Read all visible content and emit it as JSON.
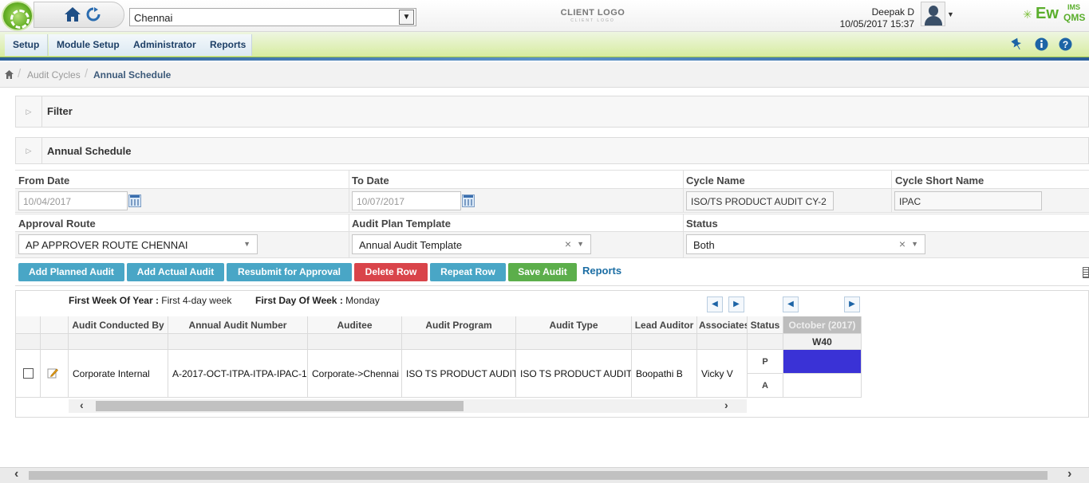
{
  "header": {
    "location": "Chennai",
    "client_logo": "CLIENT LOGO",
    "client_logo_sub": "CLIENT LOGO",
    "user_name": "Deepak D",
    "datetime": "10/05/2017 15:37",
    "brand_main": "Ew",
    "brand_top": "IMS",
    "brand_sub": "QMS"
  },
  "menu": [
    "Setup",
    "Module Setup",
    "Administrator",
    "Reports"
  ],
  "breadcrumb": [
    "Audit Cycles",
    "Annual Schedule"
  ],
  "filter_panel": {
    "title": "Filter"
  },
  "schedule_panel": {
    "title": "Annual Schedule"
  },
  "form": {
    "from_date_label": "From Date",
    "from_date": "10/04/2017",
    "to_date_label": "To Date",
    "to_date": "10/07/2017",
    "cycle_name_label": "Cycle Name",
    "cycle_name": "ISO/TS PRODUCT AUDIT CY-2",
    "cycle_short_label": "Cycle Short Name",
    "cycle_short": "IPAC",
    "approval_label": "Approval Route",
    "approval": "AP APPROVER ROUTE CHENNAI",
    "template_label": "Audit Plan Template",
    "template": "Annual Audit Template",
    "status_label": "Status",
    "status": "Both"
  },
  "buttons": {
    "add_planned": "Add Planned Audit",
    "add_actual": "Add Actual Audit",
    "resubmit": "Resubmit for Approval",
    "delete_row": "Delete Row",
    "repeat_row": "Repeat Row",
    "save_audit": "Save Audit",
    "reports": "Reports"
  },
  "week_info": {
    "first_week_label": "First Week Of Year :",
    "first_week": "First 4-day week",
    "first_day_label": "First Day Of Week :",
    "first_day": "Monday"
  },
  "grid": {
    "columns": [
      "Audit Conducted By",
      "Annual Audit Number",
      "Auditee",
      "Audit Program",
      "Audit Type",
      "Lead Auditor",
      "Associates",
      "Status"
    ],
    "month": "October (2017)",
    "week": "W40",
    "row": {
      "conducted_by": "Corporate Internal",
      "audit_number": "A-2017-OCT-ITPA-ITPA-IPAC-1",
      "auditee": "Corporate->Chennai",
      "program": "ISO TS PRODUCT AUDIT",
      "type": "ISO TS PRODUCT AUDIT",
      "lead": "Boopathi B",
      "associates": "Vicky V",
      "status_p": "P",
      "status_a": "A"
    },
    "planned_color": "#3a32d6"
  },
  "colors": {
    "menu_green": "#d7ec9f",
    "teal": "#49a6c6",
    "red": "#d9444a",
    "green": "#5cae4b"
  }
}
